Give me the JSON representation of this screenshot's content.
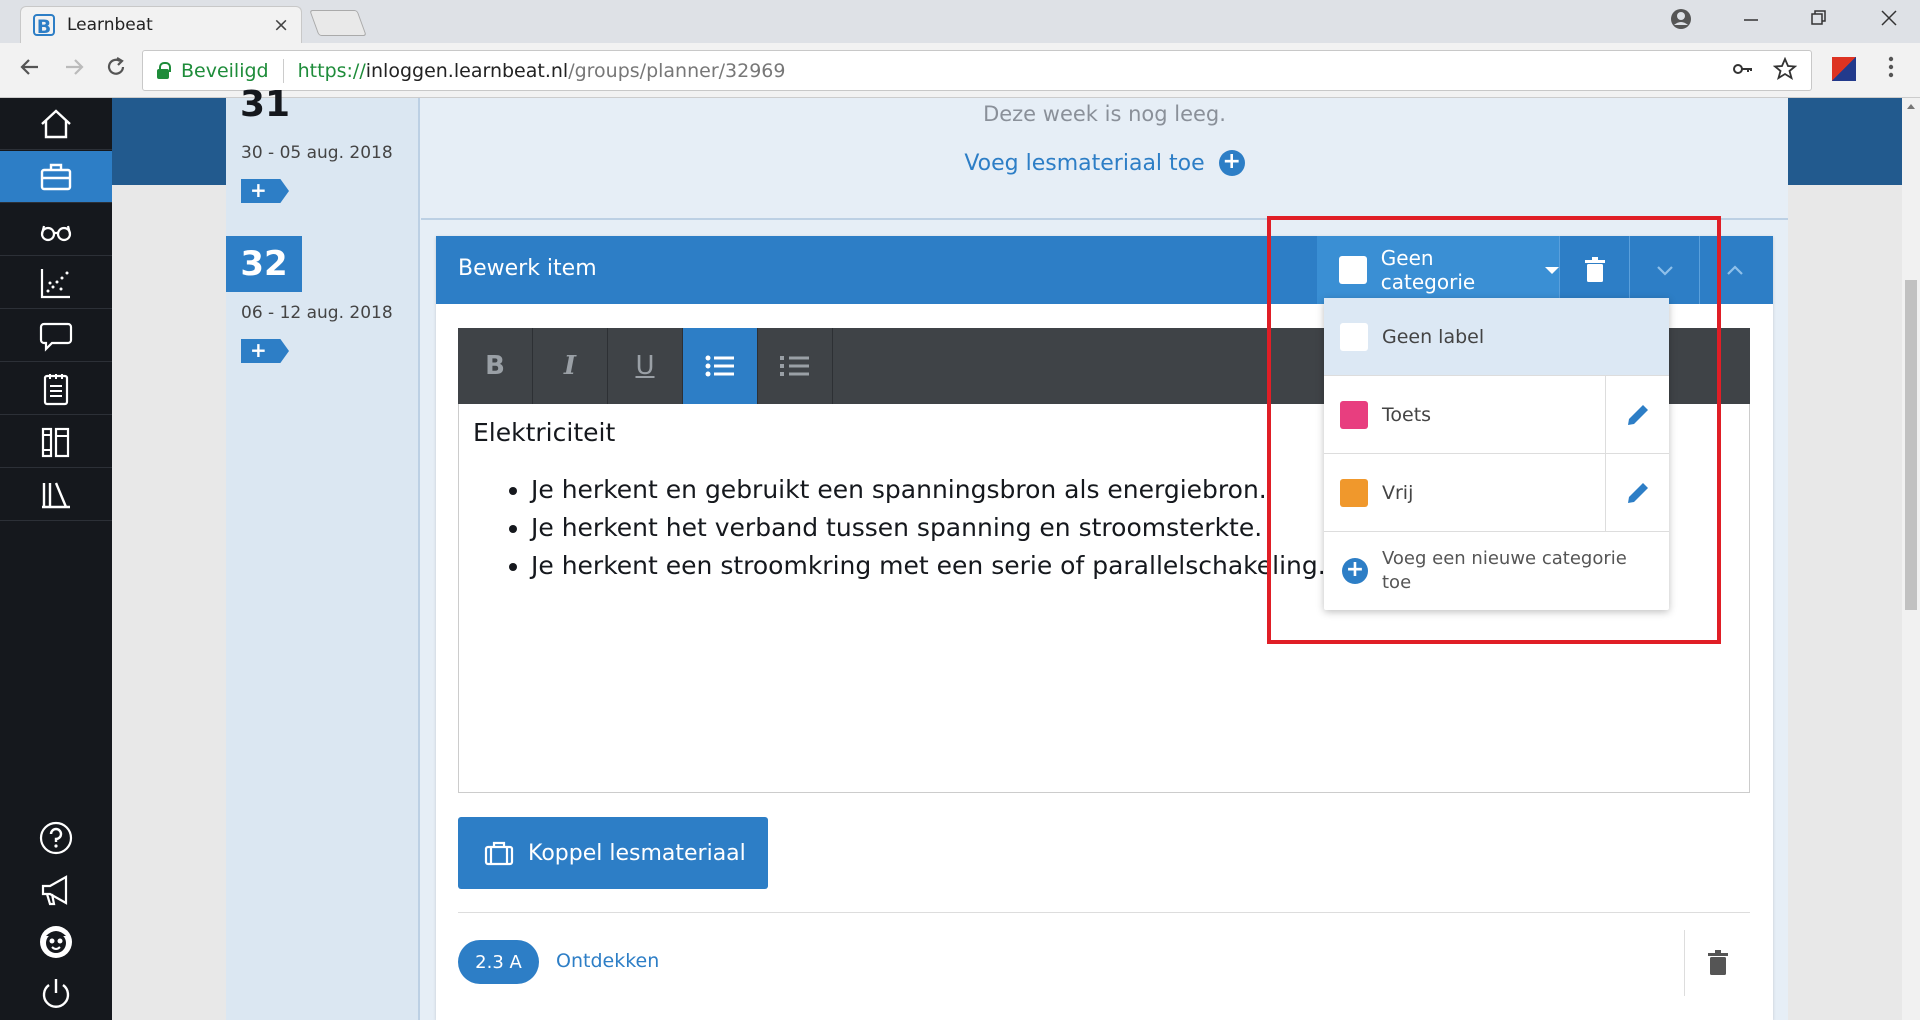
{
  "browser": {
    "tab_title": "Learnbeat",
    "tab_close": "×",
    "secure_label": "Beveiligd",
    "url_scheme": "https://",
    "url_host": "inloggen.learnbeat.nl",
    "url_path": "/groups/planner/32969"
  },
  "sidebar": {
    "items": [
      "home",
      "briefcase",
      "glasses",
      "chart",
      "chat",
      "notebook",
      "books",
      "library"
    ],
    "active": "briefcase",
    "bottom_items": [
      "help",
      "megaphone",
      "avatar",
      "power"
    ]
  },
  "weeks": [
    {
      "number": "31",
      "dates": "30 - 05 aug. 2018",
      "empty_message": "Deze week is nog leeg.",
      "add_link": "Voeg lesmateriaal toe"
    },
    {
      "number": "32",
      "dates": "06 - 12 aug. 2018"
    }
  ],
  "add_tag_label": "+",
  "editor": {
    "title": "Bewerk item",
    "category_button": "Geen categorie",
    "toolbar": {
      "bold": "B",
      "italic": "I",
      "underline": "U"
    },
    "heading": "Elektriciteit",
    "bullets": [
      "Je herkent en gebruikt een spanningsbron als energiebron.",
      "Je herkent het verband tussen spanning en stroomsterkte.",
      "Je herkent een stroomkring met een serie of parallelschakeling."
    ],
    "link_button": "Koppel lesmateriaal",
    "material": {
      "badge": "2.3 A",
      "title": "Ontdekken"
    }
  },
  "category_dropdown": {
    "items": [
      {
        "label": "Geen label",
        "color": "#ffffff",
        "selected": true
      },
      {
        "label": "Toets",
        "color": "#e83e7f",
        "selected": false
      },
      {
        "label": "Vrij",
        "color": "#f0982c",
        "selected": false
      }
    ],
    "add_new": "Voeg een nieuwe categorie toe"
  },
  "colors": {
    "primary": "#2d7ec6",
    "sidebar": "#15181d",
    "highlight": "#e01e26"
  }
}
